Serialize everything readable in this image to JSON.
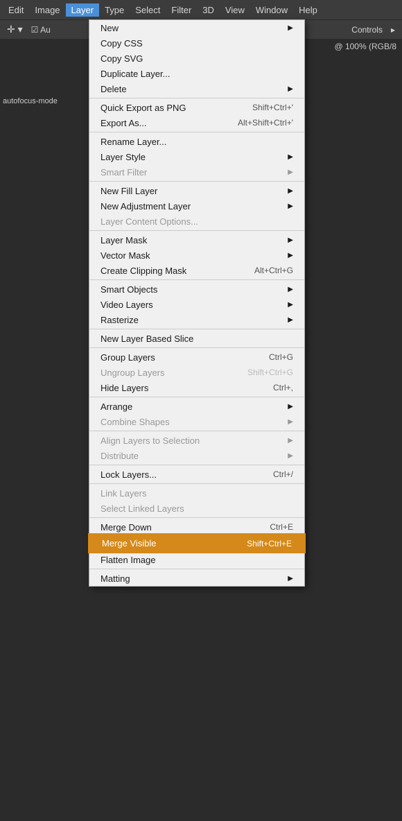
{
  "menubar": {
    "items": [
      {
        "label": "Edit",
        "active": false
      },
      {
        "label": "Image",
        "active": false
      },
      {
        "label": "Layer",
        "active": true
      },
      {
        "label": "Type",
        "active": false
      },
      {
        "label": "Select",
        "active": false
      },
      {
        "label": "Filter",
        "active": false
      },
      {
        "label": "3D",
        "active": false
      },
      {
        "label": "View",
        "active": false
      },
      {
        "label": "Window",
        "active": false
      },
      {
        "label": "Help",
        "active": false
      }
    ]
  },
  "toolbar": {
    "tool_label": "Au",
    "right_label": "Controls",
    "zoom_label": "@ 100% (RGB/8"
  },
  "left_panel": {
    "text": "autofocus-mode"
  },
  "dropdown": {
    "sections": [
      {
        "items": [
          {
            "label": "New",
            "shortcut": "",
            "arrow": true,
            "disabled": false
          },
          {
            "label": "Copy CSS",
            "shortcut": "",
            "arrow": false,
            "disabled": false
          },
          {
            "label": "Copy SVG",
            "shortcut": "",
            "arrow": false,
            "disabled": false
          },
          {
            "label": "Duplicate Layer...",
            "shortcut": "",
            "arrow": false,
            "disabled": false
          },
          {
            "label": "Delete",
            "shortcut": "",
            "arrow": true,
            "disabled": false
          }
        ]
      },
      {
        "items": [
          {
            "label": "Quick Export as PNG",
            "shortcut": "Shift+Ctrl+'",
            "arrow": false,
            "disabled": false
          },
          {
            "label": "Export As...",
            "shortcut": "Alt+Shift+Ctrl+'",
            "arrow": false,
            "disabled": false
          }
        ]
      },
      {
        "items": [
          {
            "label": "Rename Layer...",
            "shortcut": "",
            "arrow": false,
            "disabled": false
          },
          {
            "label": "Layer Style",
            "shortcut": "",
            "arrow": true,
            "disabled": false
          },
          {
            "label": "Smart Filter",
            "shortcut": "",
            "arrow": true,
            "disabled": true
          }
        ]
      },
      {
        "items": [
          {
            "label": "New Fill Layer",
            "shortcut": "",
            "arrow": true,
            "disabled": false
          },
          {
            "label": "New Adjustment Layer",
            "shortcut": "",
            "arrow": true,
            "disabled": false
          },
          {
            "label": "Layer Content Options...",
            "shortcut": "",
            "arrow": false,
            "disabled": true
          }
        ]
      },
      {
        "items": [
          {
            "label": "Layer Mask",
            "shortcut": "",
            "arrow": true,
            "disabled": false
          },
          {
            "label": "Vector Mask",
            "shortcut": "",
            "arrow": true,
            "disabled": false
          },
          {
            "label": "Create Clipping Mask",
            "shortcut": "Alt+Ctrl+G",
            "arrow": false,
            "disabled": false
          }
        ]
      },
      {
        "items": [
          {
            "label": "Smart Objects",
            "shortcut": "",
            "arrow": true,
            "disabled": false
          },
          {
            "label": "Video Layers",
            "shortcut": "",
            "arrow": true,
            "disabled": false
          },
          {
            "label": "Rasterize",
            "shortcut": "",
            "arrow": true,
            "disabled": false
          }
        ]
      },
      {
        "items": [
          {
            "label": "New Layer Based Slice",
            "shortcut": "",
            "arrow": false,
            "disabled": false
          }
        ]
      },
      {
        "items": [
          {
            "label": "Group Layers",
            "shortcut": "Ctrl+G",
            "arrow": false,
            "disabled": false
          },
          {
            "label": "Ungroup Layers",
            "shortcut": "Shift+Ctrl+G",
            "arrow": false,
            "disabled": true
          },
          {
            "label": "Hide Layers",
            "shortcut": "Ctrl+,",
            "arrow": false,
            "disabled": false
          }
        ]
      },
      {
        "items": [
          {
            "label": "Arrange",
            "shortcut": "",
            "arrow": true,
            "disabled": false
          },
          {
            "label": "Combine Shapes",
            "shortcut": "",
            "arrow": true,
            "disabled": true
          }
        ]
      },
      {
        "items": [
          {
            "label": "Align Layers to Selection",
            "shortcut": "",
            "arrow": true,
            "disabled": true
          },
          {
            "label": "Distribute",
            "shortcut": "",
            "arrow": true,
            "disabled": true
          }
        ]
      },
      {
        "items": [
          {
            "label": "Lock Layers...",
            "shortcut": "Ctrl+/",
            "arrow": false,
            "disabled": false
          }
        ]
      },
      {
        "items": [
          {
            "label": "Link Layers",
            "shortcut": "",
            "arrow": false,
            "disabled": true
          },
          {
            "label": "Select Linked Layers",
            "shortcut": "",
            "arrow": false,
            "disabled": true
          }
        ]
      },
      {
        "items": [
          {
            "label": "Merge Down",
            "shortcut": "Ctrl+E",
            "arrow": false,
            "disabled": false
          },
          {
            "label": "Merge Visible",
            "shortcut": "Shift+Ctrl+E",
            "arrow": false,
            "disabled": false,
            "highlighted": true
          },
          {
            "label": "Flatten Image",
            "shortcut": "",
            "arrow": false,
            "disabled": false
          }
        ]
      },
      {
        "items": [
          {
            "label": "Matting",
            "shortcut": "",
            "arrow": true,
            "disabled": false
          }
        ]
      }
    ]
  }
}
